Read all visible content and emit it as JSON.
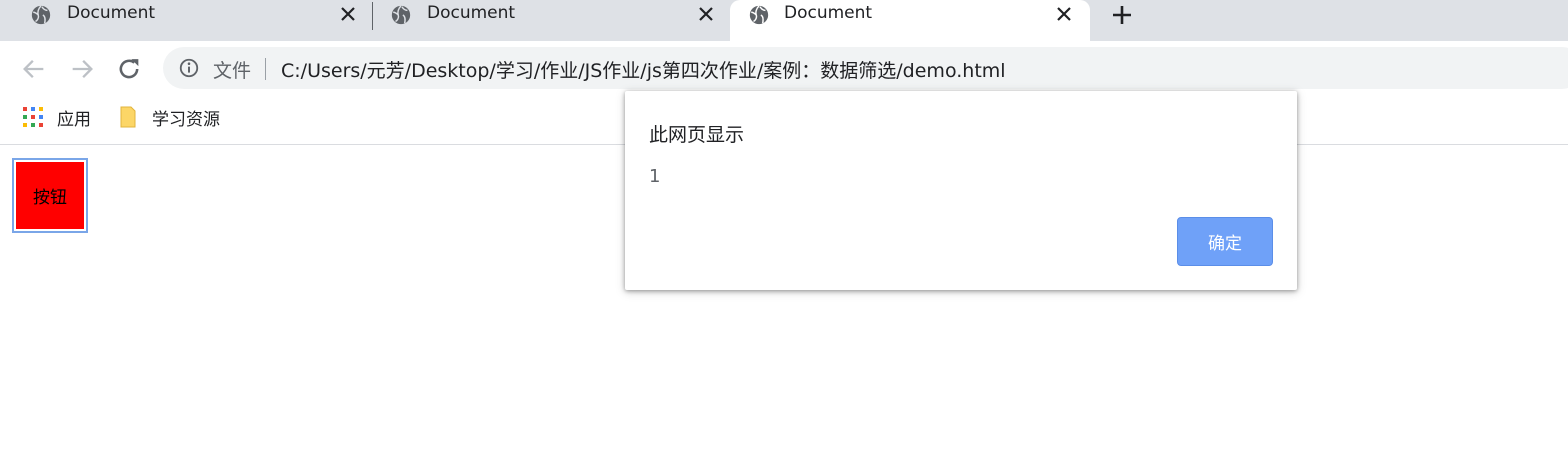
{
  "browser": {
    "tabs": [
      {
        "title": "Document",
        "active": false
      },
      {
        "title": "Document",
        "active": false
      },
      {
        "title": "Document",
        "active": true
      }
    ],
    "omnibox": {
      "security_label": "文件",
      "url": "C:/Users/元芳/Desktop/学习/作业/JS作业/js第四次作业/案例：数据筛选/demo.html"
    },
    "bookmarks": [
      {
        "label": "应用",
        "icon": "apps-grid-icon"
      },
      {
        "label": "学习资源",
        "icon": "folder-icon"
      }
    ]
  },
  "page": {
    "button_label": "按钮",
    "button_color": "#ff0000"
  },
  "alert": {
    "title": "此网页显示",
    "message": "1",
    "ok_label": "确定",
    "ok_color": "#6fa1f8"
  }
}
